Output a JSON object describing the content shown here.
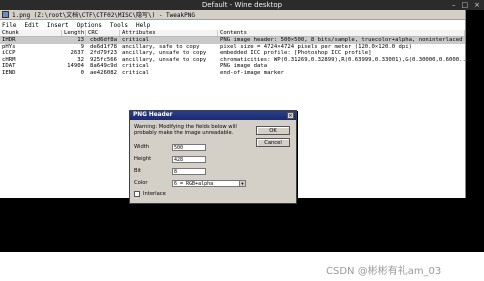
{
  "desktop": {
    "title": "Default - Wine desktop",
    "controls": [
      "–",
      "□",
      "×"
    ]
  },
  "app": {
    "title": "1.png (Z:\\root\\文档\\CTF\\CTF02\\MISC\\隐写\\) - TweakPNG",
    "menu": [
      "File",
      "Edit",
      "Insert",
      "Options",
      "Tools",
      "Help"
    ]
  },
  "table": {
    "headers": [
      "Chunk",
      "Length",
      "CRC",
      "Attributes",
      "Contents"
    ],
    "rows": [
      {
        "chunk": "IHDR",
        "length": "13",
        "crc": "cbd6df8a",
        "attr": "critical",
        "contents": "PNG image header: 500×500, 8 bits/sample, truecolor+alpha, noninterlaced"
      },
      {
        "chunk": "pHYs",
        "length": "9",
        "crc": "de6d1f78",
        "attr": "ancillary, safe to copy",
        "contents": "pixel size = 4724×4724 pixels per meter (120.0×120.0 dpi)"
      },
      {
        "chunk": "iCCP",
        "length": "2637",
        "crc": "2fd79f23",
        "attr": "ancillary, unsafe to copy",
        "contents": "embedded ICC profile: [Photoshop ICC profile]"
      },
      {
        "chunk": "cHRM",
        "length": "32",
        "crc": "925fc566",
        "attr": "ancillary, unsafe to copy",
        "contents": "chromaticities: WP(0.31269,0.32899),R(0.63999,0.33001),G(0.30000,0.6000..."
      },
      {
        "chunk": "IDAT",
        "length": "14904",
        "crc": "8a649c9d",
        "attr": "critical",
        "contents": "PNG image data"
      },
      {
        "chunk": "IEND",
        "length": "0",
        "crc": "ae426082",
        "attr": "critical",
        "contents": "end-of-image marker"
      }
    ]
  },
  "dialog": {
    "title": "PNG Header",
    "close": "×",
    "warning": "Warning: Modifying the fields below will probably make the image unreadable.",
    "ok": "OK",
    "cancel": "Cancel",
    "width_label": "Width",
    "width_value": "500",
    "height_label": "Height",
    "height_value": "428",
    "bit_label": "Bit",
    "bit_value": "8",
    "color_label": "Color",
    "color_value": "6 = RGB+alpha",
    "interlace_label": "Interlace"
  },
  "watermark": "CSDN @彬彬有礼am_03"
}
